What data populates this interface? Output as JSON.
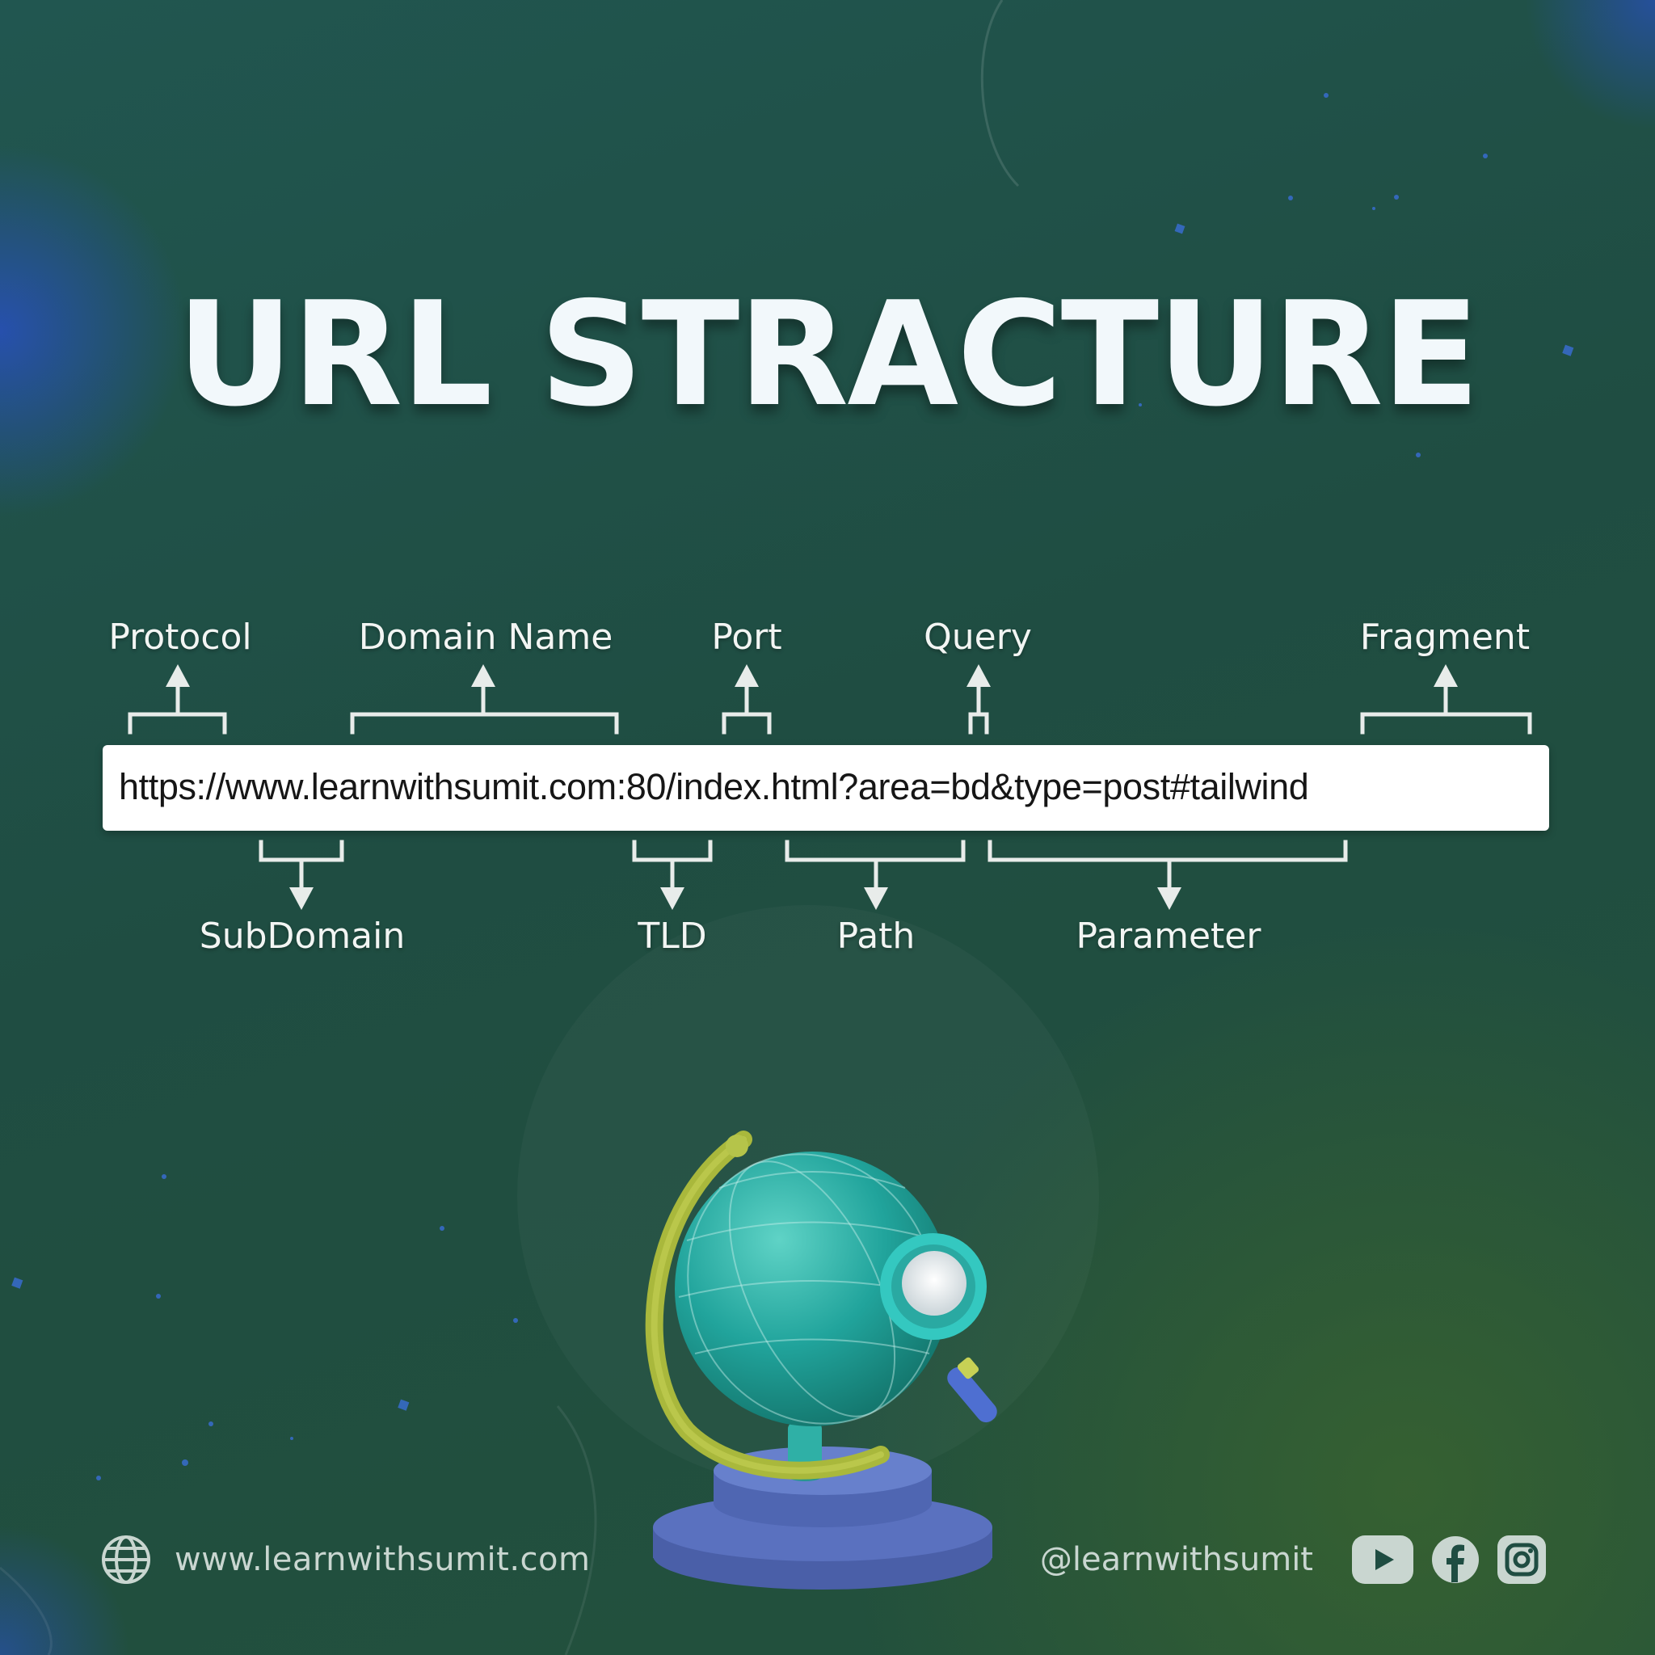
{
  "title": "URL STRACTURE",
  "url": "https://www.learnwithsumit.com:80/index.html?area=bd&type=post#tailwind",
  "labels_top": {
    "protocol": "Protocol",
    "domain_name": "Domain Name",
    "port": "Port",
    "query": "Query",
    "fragment": "Fragment"
  },
  "labels_bottom": {
    "subdomain": "SubDomain",
    "tld": "TLD",
    "path": "Path",
    "parameter": "Parameter"
  },
  "footer": {
    "website": "www.learnwithsumit.com",
    "handle": "@learnwithsumit",
    "icons": [
      "globe-icon",
      "youtube-icon",
      "facebook-icon",
      "instagram-icon"
    ]
  },
  "colors": {
    "accent_text": "#f2f8fb",
    "footer_text": "#c9d6d0",
    "bracket": "#e8ecea"
  }
}
